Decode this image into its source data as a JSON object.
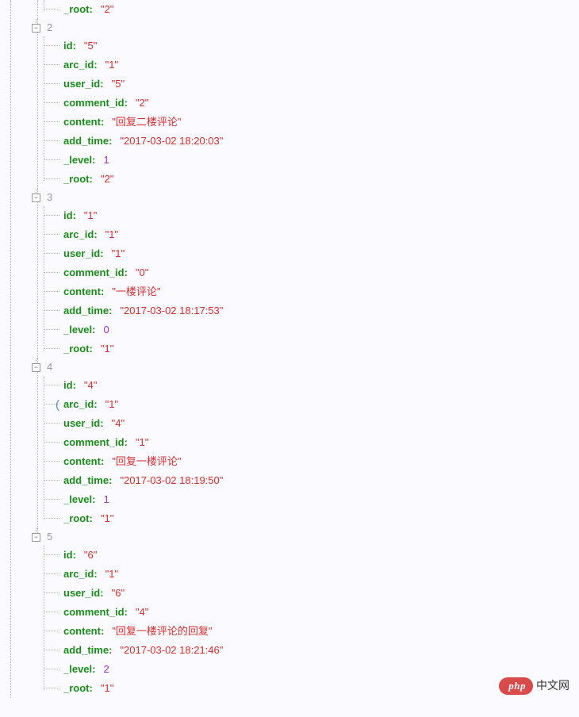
{
  "records": [
    {
      "tailOnly": true,
      "index": null,
      "props": [
        {
          "key": "_root",
          "value": "\"2\"",
          "type": "str"
        }
      ]
    },
    {
      "index": "2",
      "props": [
        {
          "key": "id",
          "value": "\"5\"",
          "type": "str"
        },
        {
          "key": "arc_id",
          "value": "\"1\"",
          "type": "str"
        },
        {
          "key": "user_id",
          "value": "\"5\"",
          "type": "str"
        },
        {
          "key": "comment_id",
          "value": "\"2\"",
          "type": "str"
        },
        {
          "key": "content",
          "value": "\"回复二楼评论\"",
          "type": "str"
        },
        {
          "key": "add_time",
          "value": "\"2017-03-02 18:20:03\"",
          "type": "str"
        },
        {
          "key": "_level",
          "value": "1",
          "type": "num"
        },
        {
          "key": "_root",
          "value": "\"2\"",
          "type": "str"
        }
      ]
    },
    {
      "index": "3",
      "props": [
        {
          "key": "id",
          "value": "\"1\"",
          "type": "str"
        },
        {
          "key": "arc_id",
          "value": "\"1\"",
          "type": "str"
        },
        {
          "key": "user_id",
          "value": "\"1\"",
          "type": "str"
        },
        {
          "key": "comment_id",
          "value": "\"0\"",
          "type": "str"
        },
        {
          "key": "content",
          "value": "\"一楼评论\"",
          "type": "str"
        },
        {
          "key": "add_time",
          "value": "\"2017-03-02 18:17:53\"",
          "type": "str"
        },
        {
          "key": "_level",
          "value": "0",
          "type": "num"
        },
        {
          "key": "_root",
          "value": "\"1\"",
          "type": "str"
        }
      ]
    },
    {
      "index": "4",
      "props": [
        {
          "key": "id",
          "value": "\"4\"",
          "type": "str"
        },
        {
          "key": "arc_id",
          "value": "\"1\"",
          "type": "str",
          "highlight": true
        },
        {
          "key": "user_id",
          "value": "\"4\"",
          "type": "str"
        },
        {
          "key": "comment_id",
          "value": "\"1\"",
          "type": "str"
        },
        {
          "key": "content",
          "value": "\"回复一楼评论\"",
          "type": "str"
        },
        {
          "key": "add_time",
          "value": "\"2017-03-02 18:19:50\"",
          "type": "str"
        },
        {
          "key": "_level",
          "value": "1",
          "type": "num"
        },
        {
          "key": "_root",
          "value": "\"1\"",
          "type": "str"
        }
      ]
    },
    {
      "index": "5",
      "props": [
        {
          "key": "id",
          "value": "\"6\"",
          "type": "str"
        },
        {
          "key": "arc_id",
          "value": "\"1\"",
          "type": "str"
        },
        {
          "key": "user_id",
          "value": "\"6\"",
          "type": "str"
        },
        {
          "key": "comment_id",
          "value": "\"4\"",
          "type": "str"
        },
        {
          "key": "content",
          "value": "\"回复一楼评论的回复\"",
          "type": "str"
        },
        {
          "key": "add_time",
          "value": "\"2017-03-02 18:21:46\"",
          "type": "str"
        },
        {
          "key": "_level",
          "value": "2",
          "type": "num"
        },
        {
          "key": "_root",
          "value": "\"1\"",
          "type": "str"
        }
      ]
    }
  ],
  "toggle_symbol": "−",
  "badge": {
    "pill": "php",
    "text": "中文网"
  }
}
